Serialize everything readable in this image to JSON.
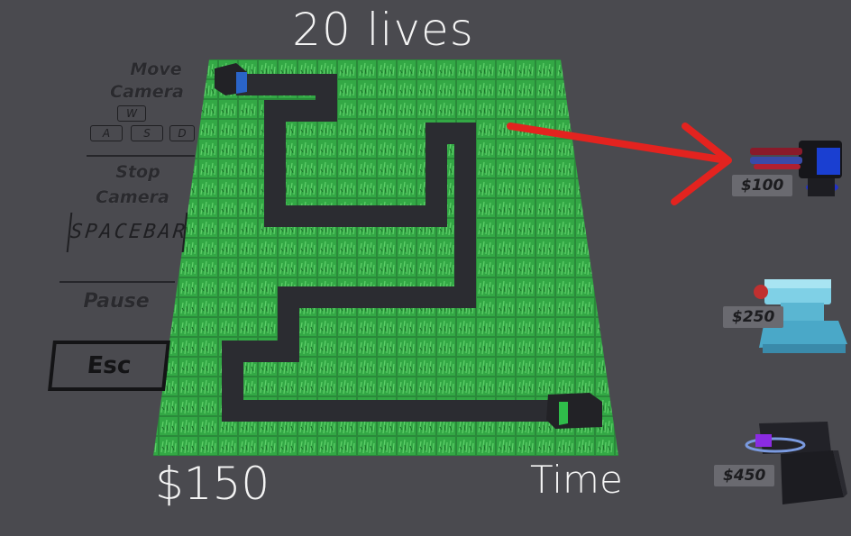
{
  "hud": {
    "lives": "20 lives",
    "money": "$150",
    "time": "Time"
  },
  "controls": {
    "move_camera_line1": "Move",
    "move_camera_line2": "Camera",
    "keys": [
      "W",
      "A",
      "S",
      "D"
    ],
    "stop_camera_line1": "Stop",
    "stop_camera_line2": "Camera",
    "spacebar": "SPACEBAR",
    "pause": "Pause",
    "esc": "Esc"
  },
  "shop": {
    "towers": [
      {
        "name": "rocket-turret",
        "price": "$100",
        "accent": "#1a3fd1"
      },
      {
        "name": "frost-cannon",
        "price": "$250",
        "accent": "#4aa8c8"
      },
      {
        "name": "plasma-tower",
        "price": "$450",
        "accent": "#8a2be2"
      }
    ]
  },
  "colors": {
    "background": "#4a4a4f",
    "grass": "#2f9a3f",
    "path": "#2b2c31",
    "arrow": "#e3231f"
  }
}
